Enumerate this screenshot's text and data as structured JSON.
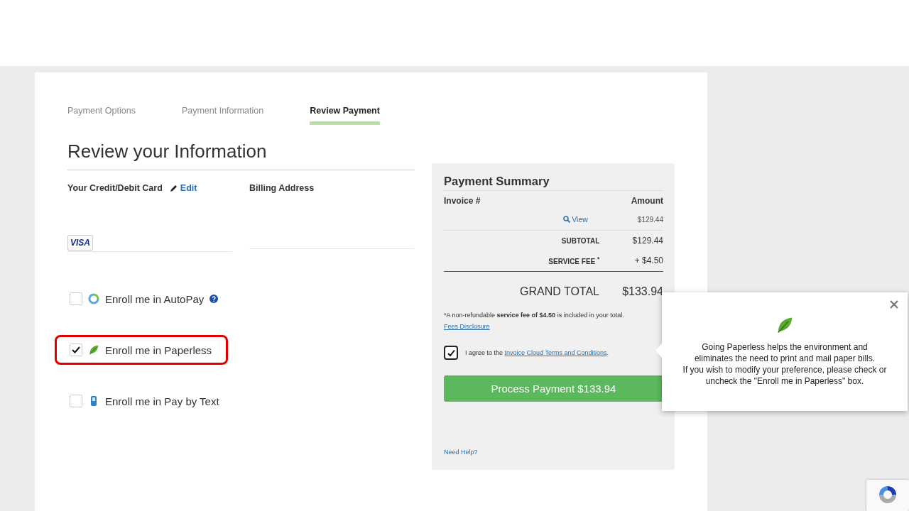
{
  "steps": [
    {
      "label": "Payment Options",
      "selected": false
    },
    {
      "label": "Payment Information",
      "selected": false
    },
    {
      "label": "Review Payment",
      "selected": true
    }
  ],
  "heading": "Review your Information",
  "card_section": {
    "title": "Your Credit/Debit Card",
    "edit_link": "Edit",
    "card_brand": "VISA"
  },
  "billing_section": {
    "title": "Billing Address"
  },
  "enroll_options": [
    {
      "kind": "autopay",
      "label": "Enroll me in AutoPay",
      "checked": false,
      "highlighted": false,
      "help": true
    },
    {
      "kind": "paperless",
      "label": "Enroll me in Paperless",
      "checked": true,
      "highlighted": true,
      "help": false
    },
    {
      "kind": "text",
      "label": "Enroll me in Pay by Text",
      "checked": false,
      "highlighted": false,
      "help": false
    }
  ],
  "summary": {
    "title": "Payment Summary",
    "columns": [
      "Invoice #",
      "Amount"
    ],
    "invoice_rows": [
      {
        "link": "View",
        "amount": "$129.44"
      }
    ],
    "totals": [
      {
        "label": "SUBTOTAL",
        "value": "$129.44"
      },
      {
        "label": "SERVICE FEE $^{*}$",
        "value": "+ $4.50"
      }
    ],
    "grand_total": {
      "label": "GRAND TOTAL",
      "value": "$133.94"
    },
    "fee_note": "*A non-refundable **service fee of $4.50** is included in your total.",
    "fees_link": "Fees Disclosure",
    "agree": {
      "checked": true,
      "text": "I agree to the ",
      "link": "Invoice Cloud Terms and Conditions",
      "after": "."
    },
    "button": "Process Payment $133.94",
    "help_link": "Need Help?"
  },
  "popover": {
    "lines": [
      "Going Paperless helps the environment and",
      "eliminates the need to print and mail paper bills.",
      "If you wish to modify your preference, please check or",
      "uncheck the \"Enroll me in Paperless\" box."
    ]
  }
}
